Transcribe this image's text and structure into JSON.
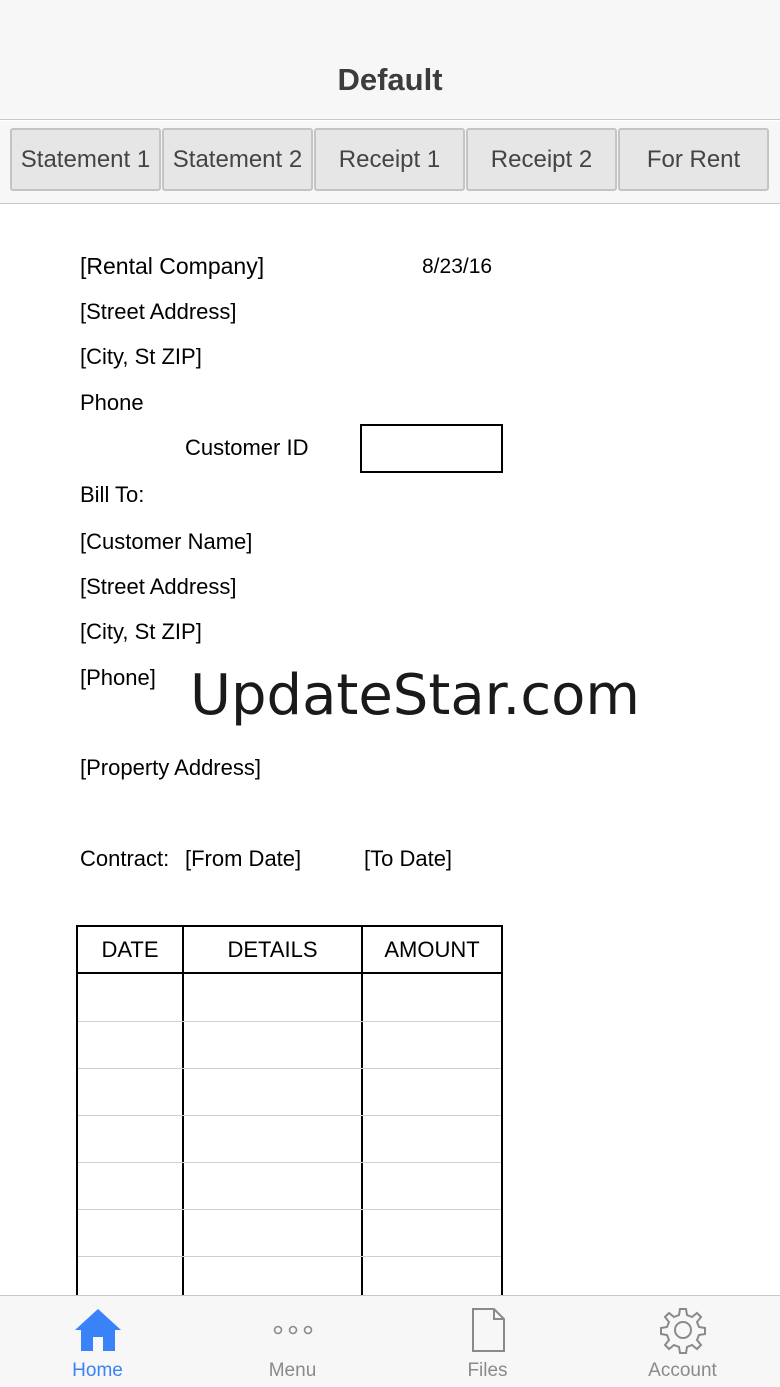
{
  "nav": {
    "title": "Default"
  },
  "tabs": [
    "Statement 1",
    "Statement 2",
    "Receipt 1",
    "Receipt 2",
    "For Rent"
  ],
  "document": {
    "company": "[Rental Company]",
    "date": "8/23/16",
    "company_street": "[Street Address]",
    "company_city": "[City, St ZIP]",
    "company_phone": "Phone",
    "customer_id_label": "Customer ID",
    "customer_id_value": "",
    "bill_to_label": "Bill To:",
    "customer_name": "[Customer Name]",
    "customer_street": "[Street Address]",
    "customer_city": "[City, St ZIP]",
    "customer_phone": "[Phone]",
    "property_address": "[Property Address]",
    "contract_label": "Contract:",
    "from_date": "[From Date]",
    "to_date": "[To Date]",
    "ledger": {
      "headers": [
        "DATE",
        "DETAILS",
        "AMOUNT"
      ],
      "rows": [
        [
          "",
          "",
          ""
        ],
        [
          "",
          "",
          ""
        ],
        [
          "",
          "",
          ""
        ],
        [
          "",
          "",
          ""
        ],
        [
          "",
          "",
          ""
        ],
        [
          "",
          "",
          ""
        ],
        [
          "",
          "",
          ""
        ]
      ]
    }
  },
  "watermark": "UpdateStar.com",
  "bottom_tabs": [
    {
      "label": "Home",
      "icon": "home-icon",
      "active": true
    },
    {
      "label": "Menu",
      "icon": "more-icon",
      "active": false
    },
    {
      "label": "Files",
      "icon": "file-icon",
      "active": false
    },
    {
      "label": "Account",
      "icon": "gear-icon",
      "active": false
    }
  ],
  "colors": {
    "accent": "#3a82f7",
    "inactive": "#8a8a8a",
    "bar_bg": "#f7f7f7"
  }
}
